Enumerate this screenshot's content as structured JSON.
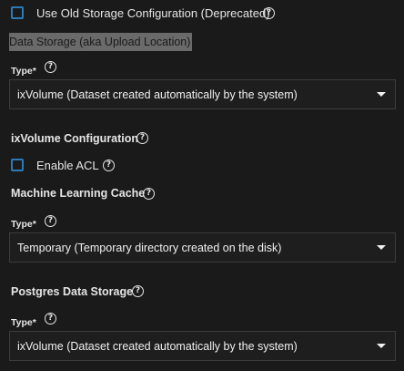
{
  "old_storage": {
    "checkbox_label": "Use Old Storage Configuration (Deprecated)"
  },
  "data_storage": {
    "heading": "Data Storage (aka Upload Location)",
    "type_label": "Type",
    "required_marker": "*",
    "select_value": "ixVolume (Dataset created automatically by the system)"
  },
  "ixvolume_config": {
    "heading": "ixVolume Configuration",
    "enable_acl_label": "Enable ACL"
  },
  "ml_cache": {
    "heading": "Machine Learning Cache",
    "type_label": "Type",
    "required_marker": "*",
    "select_value": "Temporary (Temporary directory created on the disk)"
  },
  "postgres": {
    "heading": "Postgres Data Storage",
    "type_label": "Type",
    "required_marker": "*",
    "select_value": "ixVolume (Dataset created automatically by the system)"
  },
  "help_glyph": "?",
  "colors": {
    "background": "#1a1a1a",
    "checkbox_border": "#2b7ab8",
    "highlight_bg": "#6a6a6a",
    "select_border": "#3c3c3c"
  }
}
